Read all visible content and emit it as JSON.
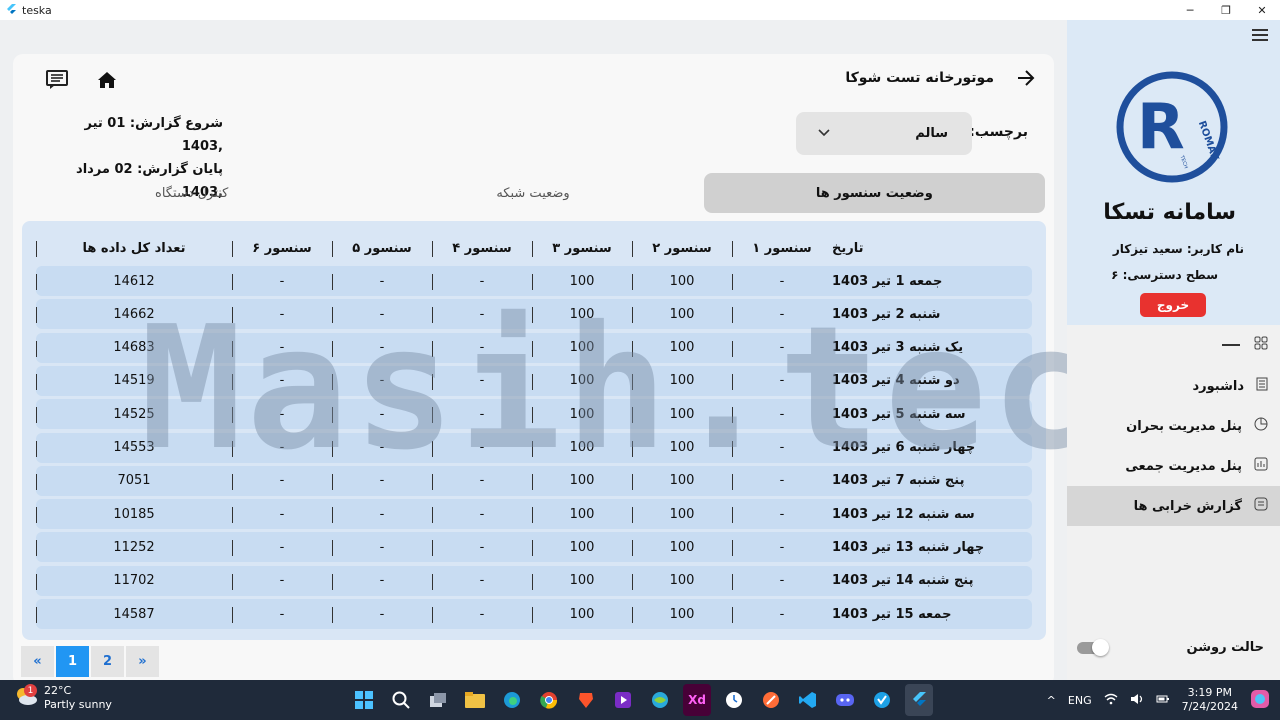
{
  "window": {
    "title": "teska"
  },
  "header": {
    "title": "موتورخانه تست شوکا"
  },
  "tag": {
    "label": "برچسب:",
    "value": "سالم"
  },
  "report": {
    "start": "شروع گزارش: 01 تیر  ,1403",
    "end": "پایان گزارش: 02 مرداد  ,1403"
  },
  "tabs": [
    {
      "label": "وضعیت سنسور ها",
      "active": true
    },
    {
      "label": "وضعیت شبکه",
      "active": false
    },
    {
      "label": "کنترل دستگاه",
      "active": false
    }
  ],
  "table": {
    "headers": [
      "تاریخ",
      "سنسور ۱",
      "سنسور ۲",
      "سنسور ۳",
      "سنسور ۴",
      "سنسور ۵",
      "سنسور ۶",
      "تعداد کل داده ها"
    ],
    "rows": [
      [
        "جمعه 1 تیر 1403",
        "-",
        "100",
        "100",
        "-",
        "-",
        "-",
        "14612"
      ],
      [
        "شنبه 2 تیر 1403",
        "-",
        "100",
        "100",
        "-",
        "-",
        "-",
        "14662"
      ],
      [
        "یک شنبه 3 تیر 1403",
        "-",
        "100",
        "100",
        "-",
        "-",
        "-",
        "14683"
      ],
      [
        "دو شنبه 4 تیر 1403",
        "-",
        "100",
        "100",
        "-",
        "-",
        "-",
        "14519"
      ],
      [
        "سه شنبه 5 تیر 1403",
        "-",
        "100",
        "100",
        "-",
        "-",
        "-",
        "14525"
      ],
      [
        "چهار شنبه 6 تیر 1403",
        "-",
        "100",
        "100",
        "-",
        "-",
        "-",
        "14553"
      ],
      [
        "پنج شنبه 7 تیر 1403",
        "-",
        "100",
        "100",
        "-",
        "-",
        "-",
        "7051"
      ],
      [
        "سه شنبه 12 تیر 1403",
        "-",
        "100",
        "100",
        "-",
        "-",
        "-",
        "10185"
      ],
      [
        "چهار شنبه 13 تیر 1403",
        "-",
        "100",
        "100",
        "-",
        "-",
        "-",
        "11252"
      ],
      [
        "پنج شنبه 14 تیر 1403",
        "-",
        "100",
        "100",
        "-",
        "-",
        "-",
        "11702"
      ],
      [
        "جمعه 15 تیر 1403",
        "-",
        "100",
        "100",
        "-",
        "-",
        "-",
        "14587"
      ]
    ]
  },
  "pager": {
    "first": "«",
    "pages": [
      "1",
      "2"
    ],
    "last": "»",
    "current": "1"
  },
  "sidebar": {
    "logo_text": "ROMAK",
    "logo_sub": "TECH",
    "title": "سامانه تسکا",
    "user": "نام کاربر: سعید تیزکار",
    "access": "سطح دسترسی: ۶",
    "logout": "خروج",
    "items": [
      {
        "label": "داشبورد",
        "icon": "document-icon",
        "active": false
      },
      {
        "label": "پنل مدیریت بحران",
        "icon": "pie-chart-icon",
        "active": false
      },
      {
        "label": "پنل مدیریت جمعی",
        "icon": "bar-chart-icon",
        "active": false
      },
      {
        "label": "گزارش خرابی ها",
        "icon": "report-icon",
        "active": true
      }
    ],
    "theme_label": "حالت روشن"
  },
  "watermark": "Masih.tech",
  "taskbar": {
    "temp": "22°C",
    "weather": "Partly sunny",
    "badge": "1",
    "lang": "ENG",
    "time": "3:19 PM",
    "date": "7/24/2024"
  }
}
